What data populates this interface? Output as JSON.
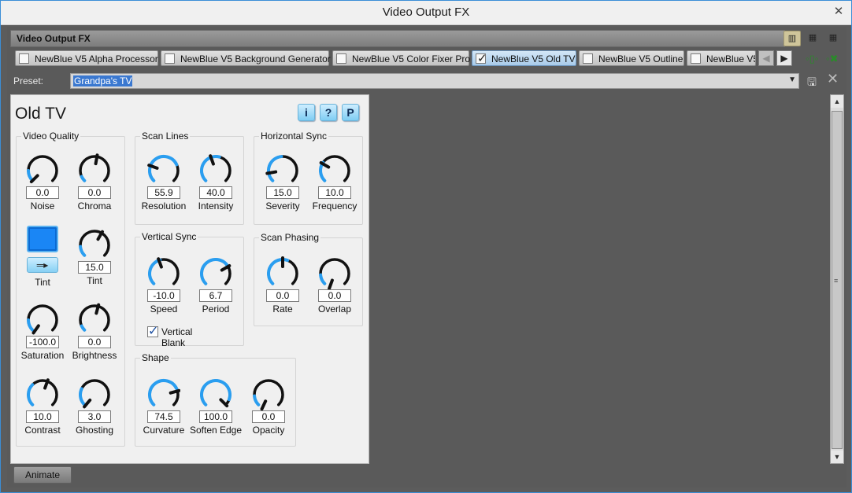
{
  "window": {
    "title": "Video Output FX",
    "close_glyph": "✕"
  },
  "fx_header": {
    "label": "Video Output FX"
  },
  "tabs": [
    {
      "label": "NewBlue V5 Alpha Processor",
      "checked": false
    },
    {
      "label": "NewBlue V5 Background Generator",
      "checked": false
    },
    {
      "label": "NewBlue V5 Color Fixer Pro",
      "checked": false
    },
    {
      "label": "NewBlue V5 Old TV",
      "checked": true,
      "active": true
    },
    {
      "label": "NewBlue V5 Outline",
      "checked": false
    },
    {
      "label": "NewBlue V5",
      "checked": false
    }
  ],
  "preset": {
    "label": "Preset:",
    "value": "Grandpa's TV"
  },
  "panel": {
    "title": "Old TV",
    "header_buttons": {
      "info": "i",
      "help": "?",
      "p": "P"
    },
    "groups": {
      "video_quality": "Video Quality",
      "scan_lines": "Scan Lines",
      "horizontal_sync": "Horizontal Sync",
      "vertical_sync": "Vertical Sync",
      "scan_phasing": "Scan Phasing",
      "shape": "Shape"
    },
    "knobs": {
      "noise": {
        "label": "Noise",
        "value": "0.0"
      },
      "chroma": {
        "label": "Chroma",
        "value": "0.0"
      },
      "tint": {
        "label": "Tint",
        "value": "15.0"
      },
      "saturation": {
        "label": "Saturation",
        "value": "-100.0"
      },
      "brightness": {
        "label": "Brightness",
        "value": "0.0"
      },
      "contrast": {
        "label": "Contrast",
        "value": "10.0"
      },
      "ghosting": {
        "label": "Ghosting",
        "value": "3.0"
      },
      "resolution": {
        "label": "Resolution",
        "value": "55.9"
      },
      "intensity": {
        "label": "Intensity",
        "value": "40.0"
      },
      "severity": {
        "label": "Severity",
        "value": "15.0"
      },
      "frequency": {
        "label": "Frequency",
        "value": "10.0"
      },
      "speed": {
        "label": "Speed",
        "value": "-10.0"
      },
      "period": {
        "label": "Period",
        "value": "6.7"
      },
      "rate": {
        "label": "Rate",
        "value": "0.0"
      },
      "overlap": {
        "label": "Overlap",
        "value": "0.0"
      },
      "curvature": {
        "label": "Curvature",
        "value": "74.5"
      },
      "soften_edge": {
        "label": "Soften Edge",
        "value": "100.0"
      },
      "opacity": {
        "label": "Opacity",
        "value": "0.0"
      }
    },
    "tint_color": {
      "label": "Tint",
      "color": "#1a86f5"
    },
    "vertical_blank": {
      "label": "Vertical Blank",
      "checked": true
    }
  },
  "buttons": {
    "animate": "Animate"
  },
  "colors": {
    "knob_arc": "#2a9ef0",
    "knob_ring": "#111111",
    "accent": "#3a78d0"
  }
}
